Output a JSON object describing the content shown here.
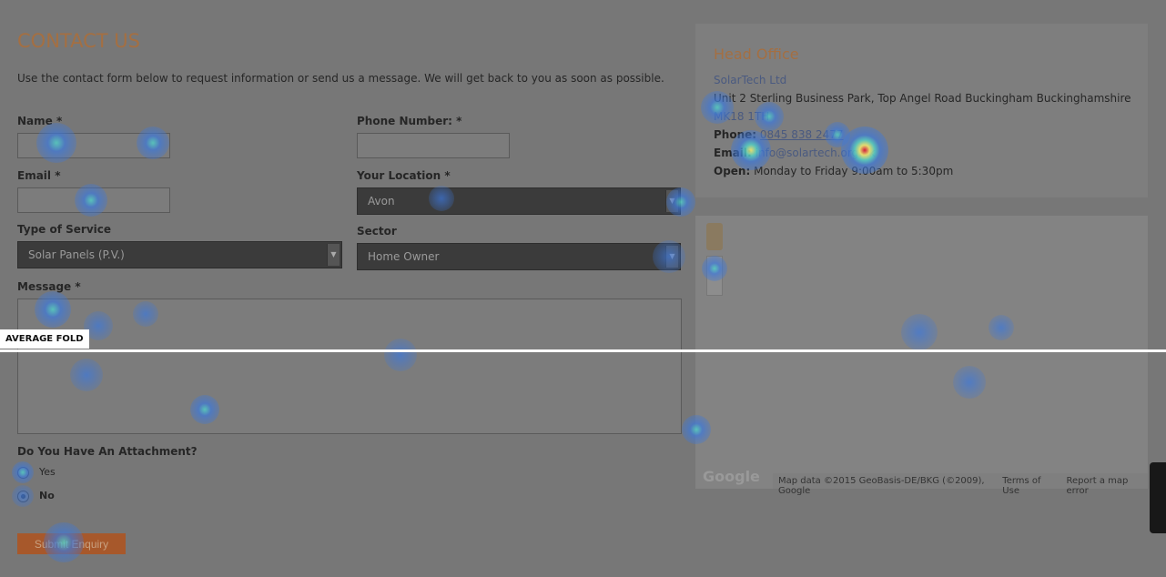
{
  "contact": {
    "title": "CONTACT US",
    "intro": "Use the contact form below to request information or send us a message. We will get back to you as soon as possible.",
    "name_label": "Name *",
    "phone_label": "Phone Number: *",
    "email_label": "Email *",
    "location_label": "Your Location *",
    "location_value": "Avon",
    "service_label": "Type of Service",
    "service_value": "Solar Panels (P.V.)",
    "sector_label": "Sector",
    "sector_value": "Home Owner",
    "message_label": "Message *",
    "attachment_label": "Do You Have An Attachment?",
    "yes": "Yes",
    "no": "No",
    "attachment_selected": "No",
    "submit": "Submit Enquiry"
  },
  "office": {
    "title": "Head Office",
    "company": "SolarTech Ltd",
    "address": "Unit 2 Sterling Business Park, Top Angel Road Buckingham Buckinghamshire",
    "postcode": "MK18 1TH",
    "phone_label": "Phone:",
    "phone": "0845 838 2477",
    "email_label": "Email:",
    "email": "info@solartech.org.uk",
    "open_label": "Open:",
    "open": "Monday to Friday 9:00am to 5:30pm"
  },
  "map": {
    "logo": "Google",
    "data": "Map data ©2015 GeoBasis-DE/BKG (©2009), Google",
    "terms": "Terms of Use",
    "report": "Report a map error"
  },
  "heatmap": {
    "fold_label": "AVERAGE FOLD",
    "hot_color": "#d0203a",
    "warm_color": "#f0e070",
    "cool_color": "#3a7ad8"
  }
}
